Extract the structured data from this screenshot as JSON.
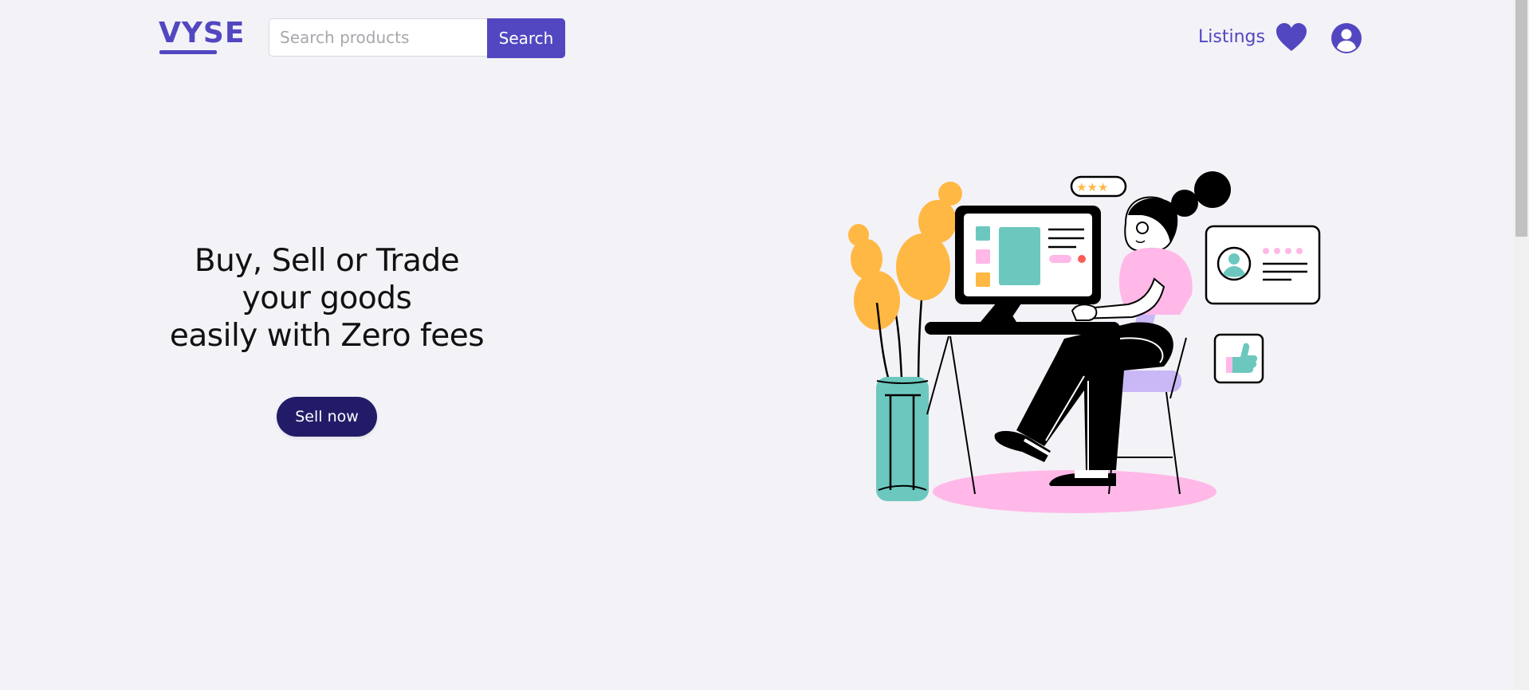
{
  "header": {
    "logo_text": "VYSE",
    "search": {
      "placeholder": "Search products",
      "value": "",
      "button_label": "Search"
    },
    "nav": {
      "listings_label": "Listings",
      "favorites_icon": "heart-icon",
      "account_icon": "user-circle-icon"
    }
  },
  "hero": {
    "headline_lines": [
      "Buy, Sell or Trade",
      "your goods",
      "easily with Zero fees"
    ],
    "cta_label": "Sell now",
    "illustration": "woman-working-at-computer-illustration"
  },
  "colors": {
    "brand": "#5247c0",
    "cta": "#221c68",
    "background": "#f3f2f7",
    "accent_teal": "#6cc8bf",
    "accent_yellow": "#ffb844",
    "accent_pink": "#ffb8e8",
    "accent_lavender": "#c9b8f5"
  }
}
